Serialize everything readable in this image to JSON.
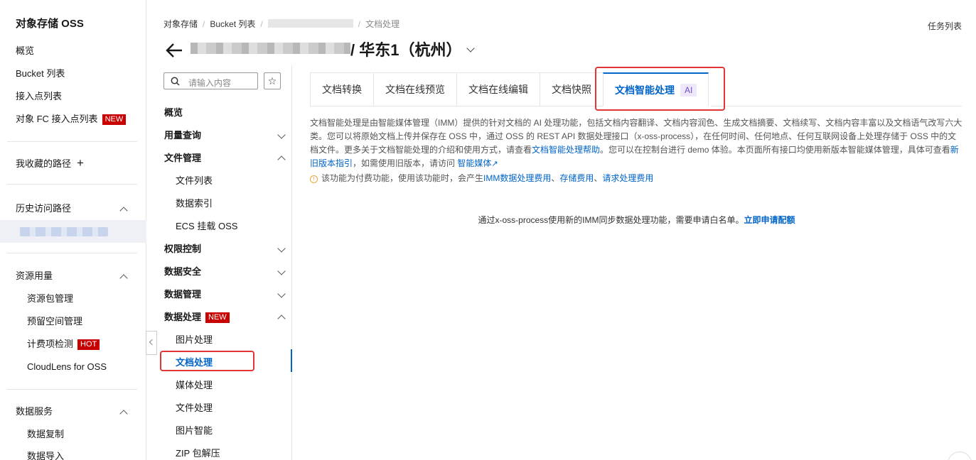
{
  "global_sidebar": {
    "title": "对象存储 OSS",
    "items": [
      "概览",
      "Bucket 列表",
      "接入点列表",
      "对象 FC 接入点列表"
    ],
    "fc_tag": "NEW",
    "favorites_label": "我收藏的路径",
    "history_label": "历史访问路径",
    "resource_label": "资源用量",
    "resource_items": [
      "资源包管理",
      "预留空间管理",
      "计费项检测",
      "CloudLens for OSS"
    ],
    "hot_tag": "HOT",
    "data_service_label": "数据服务",
    "data_service_items": [
      "数据复制",
      "数据导入"
    ]
  },
  "header": {
    "breadcrumb": [
      "对象存储",
      "Bucket 列表",
      "文档处理"
    ],
    "task_list": "任务列表",
    "bucket_region": "/ 华东1（杭州）"
  },
  "secondary_nav": {
    "search_placeholder": "请输入内容",
    "groups": {
      "overview": "概览",
      "usage": "用量查询",
      "file_mgmt": "文件管理",
      "file_list": "文件列表",
      "data_index": "数据索引",
      "ecs_mount": "ECS 挂载 OSS",
      "access": "权限控制",
      "security": "数据安全",
      "data_mgmt": "数据管理",
      "processing": "数据处理",
      "processing_tag": "NEW",
      "image": "图片处理",
      "doc": "文档处理",
      "media": "媒体处理",
      "file_proc": "文件处理",
      "image_ai": "图片智能",
      "zip": "ZIP 包解压"
    }
  },
  "tabs": [
    "文档转换",
    "文档在线预览",
    "文档在线编辑",
    "文档快照",
    "文档智能处理"
  ],
  "active_tab_badge": "AI",
  "content": {
    "desc_1": "文档智能处理是由智能媒体管理（IMM）提供的针对文档的 AI 处理功能，包括文档内容翻译、文档内容润色、生成文档摘要、文档续写、文档内容丰富以及文档语气改写六大类。您可以将原始文档上传并保存在 OSS 中，通过 OSS 的 REST API 数据处理接口（x-oss-process），在任何时间、任何地点、任何互联网设备上处理存储于 OSS 中的文档文件。更多关于文档智能处理的介绍和使用方式，请查看",
    "desc_link_1": "文档智能处理帮助",
    "desc_2": "。您可以在控制台进行 demo 体验。本页面所有接口均使用新版本智能媒体管理，具体可查看",
    "desc_link_2": "新旧版本指引",
    "desc_3": "，如需使用旧版本，请访问 ",
    "desc_link_3": "智能媒体",
    "note_text": "该功能为付费功能，使用该功能时，会产生",
    "note_links": [
      "IMM数据处理费用",
      "存储费用",
      "请求处理费用"
    ],
    "whitelist_text": "通过x-oss-process使用新的IMM同步数据处理功能，需要申请白名单。",
    "whitelist_link": "立即申请配额"
  }
}
